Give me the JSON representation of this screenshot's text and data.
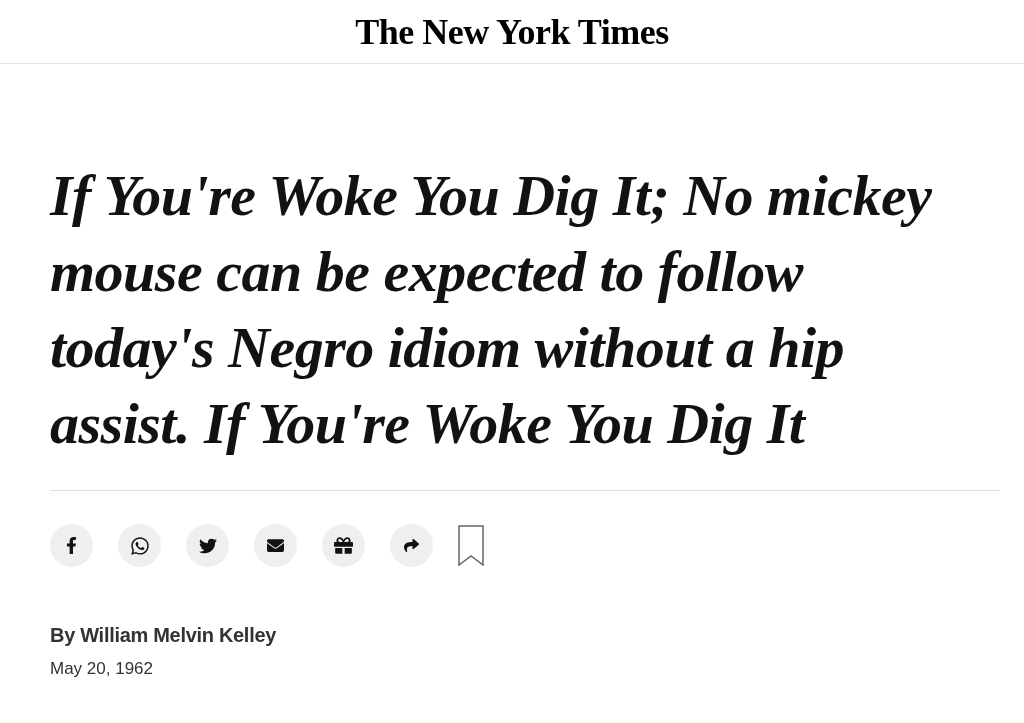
{
  "masthead": {
    "title": "The New York Times"
  },
  "article": {
    "headline": "If You're Woke You Dig It; No mickey mouse can be expected to follow today's Negro idiom without a hip assist. If You're Woke You Dig It"
  },
  "share_buttons": [
    {
      "kind": "facebook"
    },
    {
      "kind": "whatsapp"
    },
    {
      "kind": "twitter"
    },
    {
      "kind": "email"
    },
    {
      "kind": "gift"
    },
    {
      "kind": "share"
    }
  ],
  "bookmark": {
    "saved": false
  },
  "byline": {
    "author": "By William Melvin Kelley",
    "date": "May 20, 1962"
  }
}
